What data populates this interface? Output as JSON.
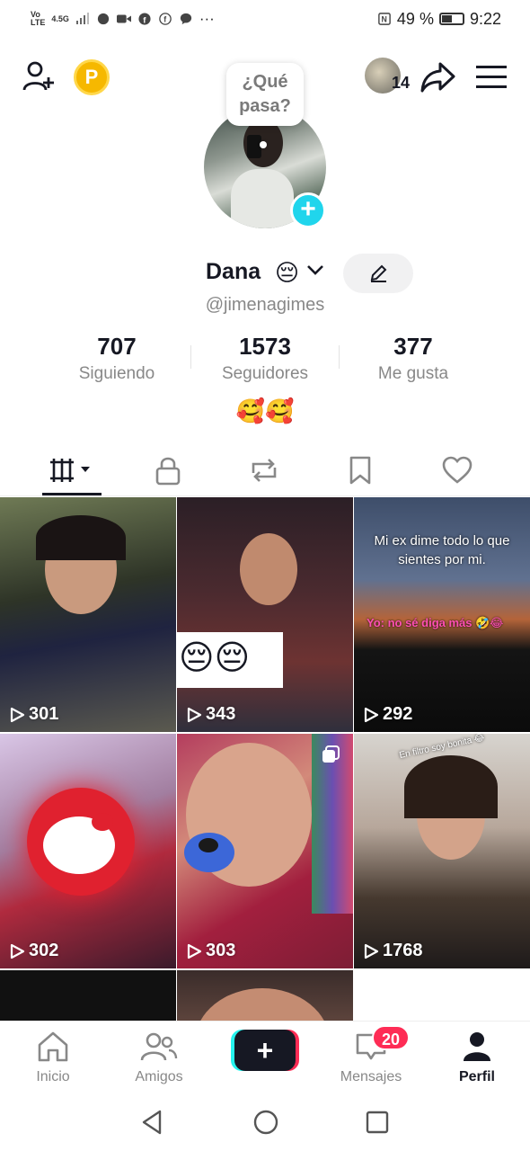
{
  "status_bar": {
    "carrier_top": "Vo",
    "carrier_bottom": "LTE",
    "network": "4.5G",
    "more": "···",
    "battery_percent": "49 %",
    "time": "9:22"
  },
  "top_bar": {
    "coin_letter": "P",
    "friends_count": "14"
  },
  "profile": {
    "status_bubble": "¿Qué pasa?",
    "display_name": "Dana",
    "name_emoji": "😔",
    "username": "@jimenagimes",
    "bio_emojis": "🥰🥰"
  },
  "stats": [
    {
      "value": "707",
      "label": "Siguiendo"
    },
    {
      "value": "1573",
      "label": "Seguidores"
    },
    {
      "value": "377",
      "label": "Me gusta"
    }
  ],
  "grid": {
    "videos": [
      {
        "views": "301"
      },
      {
        "views": "343",
        "emojis": "😔😔"
      },
      {
        "views": "292",
        "caption": "Mi ex dime todo lo que sientes por mi.",
        "reply": "Yo: no sé diga más 🤣😂"
      },
      {
        "views": "302"
      },
      {
        "views": "303"
      },
      {
        "views": "1768",
        "caption": "En filtro soy bonita 😂"
      }
    ]
  },
  "bottom_nav": {
    "items": [
      {
        "label": "Inicio"
      },
      {
        "label": "Amigos"
      },
      {
        "label": "Mensajes",
        "badge": "20"
      },
      {
        "label": "Perfil"
      }
    ],
    "create_symbol": "+"
  },
  "colors": {
    "accent_cyan": "#20d5ec",
    "accent_pink": "#fe2c55",
    "text_primary": "#161823",
    "text_secondary": "#888888"
  }
}
